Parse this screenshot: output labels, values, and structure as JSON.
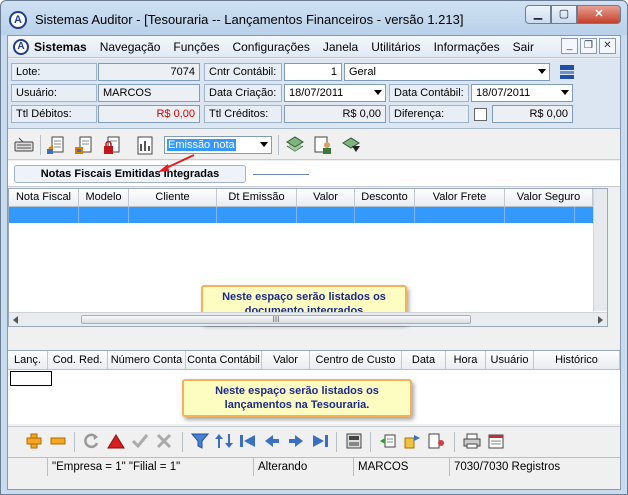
{
  "window": {
    "title": "Sistemas Auditor - [Tesouraria -- Lançamentos Financeiros - versão 1.213]",
    "buttons": [
      "minimize",
      "maximize",
      "close"
    ]
  },
  "menubar": {
    "items": [
      "Sistemas",
      "Navegação",
      "Funções",
      "Configurações",
      "Janela",
      "Utilitários",
      "Informações",
      "Sair"
    ]
  },
  "form": {
    "lote_label": "Lote:",
    "lote_value": "7074",
    "cntr_label": "Cntr Contábil:",
    "cntr_value": "1",
    "cntr_name": "Geral",
    "usuario_label": "Usuário:",
    "usuario_value": "MARCOS",
    "data_criacao_label": "Data Criação:",
    "data_criacao_value": "18/07/2011",
    "data_contabil_label": "Data Contábil:",
    "data_contabil_value": "18/07/2011",
    "ttl_debitos_label": "Ttl Débitos:",
    "ttl_debitos_value": "R$ 0,00",
    "ttl_creditos_label": "Ttl Créditos:",
    "ttl_creditos_value": "R$ 0,00",
    "diferenca_label": "Diferença:",
    "diferenca_value": "R$ 0,00"
  },
  "toolbar": {
    "emissao_select": "Emissão nota"
  },
  "section": {
    "tab_label": "Notas Fiscais Emitidas Integradas"
  },
  "grid_notas": {
    "columns": [
      "Nota Fiscal",
      "Modelo",
      "Cliente",
      "Dt Emissão",
      "Valor",
      "Desconto",
      "Valor Frete",
      "Valor Seguro"
    ],
    "note": "Neste espaço serão listados os documento integrados",
    "scroll_thumb": "III"
  },
  "grid_lancamentos": {
    "columns": [
      "Lanç.",
      "Cod. Red.",
      "Número Conta",
      "Conta Contábil",
      "Valor",
      "Centro de Custo",
      "Data",
      "Hora",
      "Usuário",
      "Histórico"
    ],
    "note": "Neste espaço serão listados os lançamentos na Tesouraria."
  },
  "status": {
    "empresa": "\"Empresa = 1\"   \"Filial = 1\"",
    "modo": "Alterando",
    "usuario": "MARCOS",
    "registros": "7030/7030 Registros"
  },
  "colors": {
    "selection": "#3399ff",
    "note_bg": "#fdfdc2",
    "note_border": "#f5b25a",
    "note_text": "#1b2a8f",
    "negative": "#dd0000"
  }
}
